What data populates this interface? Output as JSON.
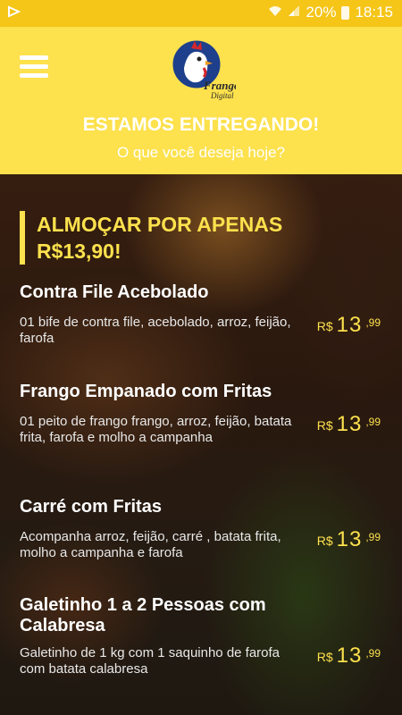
{
  "status_bar": {
    "signal_pct": "20%",
    "time": "18:15"
  },
  "header": {
    "logo_text": "Frango Digital",
    "title": "ESTAMOS ENTREGANDO!",
    "subtitle": "O que você deseja hoje?"
  },
  "section": {
    "title": "ALMOÇAR POR APENAS R$13,90!"
  },
  "items": [
    {
      "name": "Contra File Acebolado",
      "description": "01 bife de contra file, acebolado, arroz, feijão, farofa",
      "currency": "R$",
      "price_int": "13",
      "price_cents": ",99"
    },
    {
      "name": "Frango Empanado com Fritas",
      "description": "01 peito de frango frango, arroz, feijão, batata frita, farofa e molho a campanha",
      "currency": "R$",
      "price_int": "13",
      "price_cents": ",99"
    },
    {
      "name": "Carré com Fritas",
      "description": "Acompanha arroz, feijão, carré , batata frita, molho a campanha e farofa",
      "currency": "R$",
      "price_int": "13",
      "price_cents": ",99"
    },
    {
      "name": "Galetinho 1 a 2 Pessoas com Calabresa",
      "description": "Galetinho de 1 kg com 1 saquinho de farofa com batata calabresa",
      "currency": "R$",
      "price_int": "13",
      "price_cents": ",99"
    }
  ],
  "colors": {
    "brand_yellow": "#fde14d",
    "price_yellow": "#fde14d"
  }
}
